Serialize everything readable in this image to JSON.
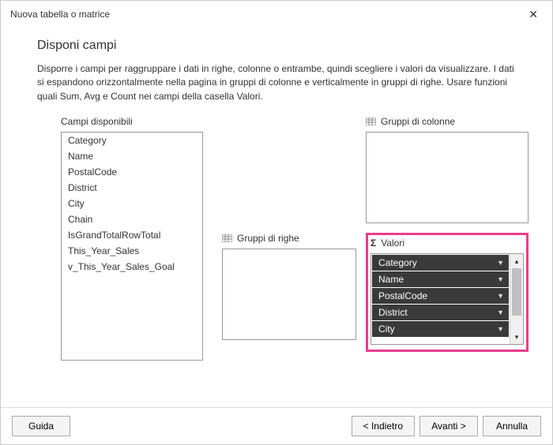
{
  "window": {
    "title": "Nuova tabella o matrice"
  },
  "page": {
    "heading": "Disponi campi",
    "description": "Disporre i campi per raggruppare i dati in righe, colonne o entrambe, quindi scegliere i valori da visualizzare. I dati si espandono orizzontalmente nella pagina in gruppi di colonne e verticalmente in gruppi di righe. Usare funzioni quali Sum, Avg e Count nei campi della casella Valori."
  },
  "labels": {
    "available": "Campi disponibili",
    "colGroups": "Gruppi di colonne",
    "rowGroups": "Gruppi di righe",
    "values": "Valori"
  },
  "availableFields": [
    "Category",
    "Name",
    "PostalCode",
    "District",
    "City",
    "Chain",
    "IsGrandTotalRowTotal",
    "This_Year_Sales",
    "v_This_Year_Sales_Goal"
  ],
  "valuesFields": [
    "Category",
    "Name",
    "PostalCode",
    "District",
    "City"
  ],
  "buttons": {
    "help": "Guida",
    "back": "< Indietro",
    "next": "Avanti >",
    "cancel": "Annulla"
  }
}
